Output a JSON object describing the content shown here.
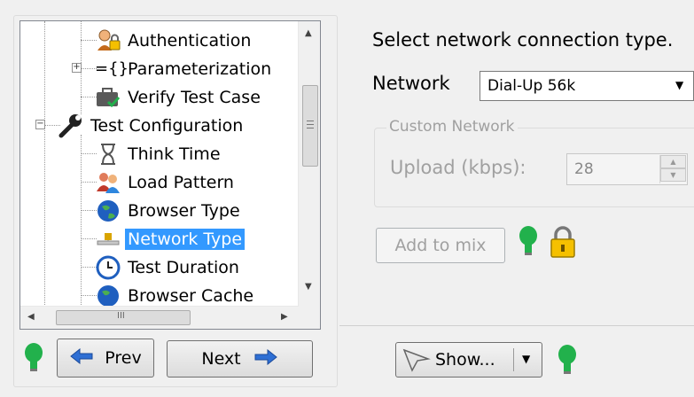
{
  "tree": {
    "items": [
      {
        "label": "Authentication",
        "icon": "authentication-icon"
      },
      {
        "label": "Parameterization",
        "icon": "parameterization-icon"
      },
      {
        "label": "Verify Test Case",
        "icon": "verify-test-case-icon"
      },
      {
        "label": "Test Configuration",
        "icon": "wrench-icon"
      },
      {
        "label": "Think Time",
        "icon": "hourglass-icon"
      },
      {
        "label": "Load Pattern",
        "icon": "users-icon"
      },
      {
        "label": "Browser Type",
        "icon": "globe-icon"
      },
      {
        "label": "Network Type",
        "icon": "network-icon",
        "selected": true
      },
      {
        "label": "Test Duration",
        "icon": "clock-icon"
      },
      {
        "label": "Browser Cache",
        "icon": "globe-icon"
      }
    ],
    "param_glyph": "={}",
    "hscroll_grip": "III"
  },
  "nav": {
    "prev_label": "Prev",
    "next_label": "Next"
  },
  "main": {
    "heading": "Select network connection type.",
    "network_label": "Network",
    "network_value": "Dial-Up 56k",
    "custom_network_legend": "Custom Network",
    "upload_label": "Upload (kbps):",
    "upload_value": "28",
    "add_to_mix_label": "Add to mix",
    "show_label": "Show..."
  },
  "colors": {
    "selection": "#3399ff",
    "bulb_green": "#22b14c",
    "lock_gold": "#f5c000"
  }
}
